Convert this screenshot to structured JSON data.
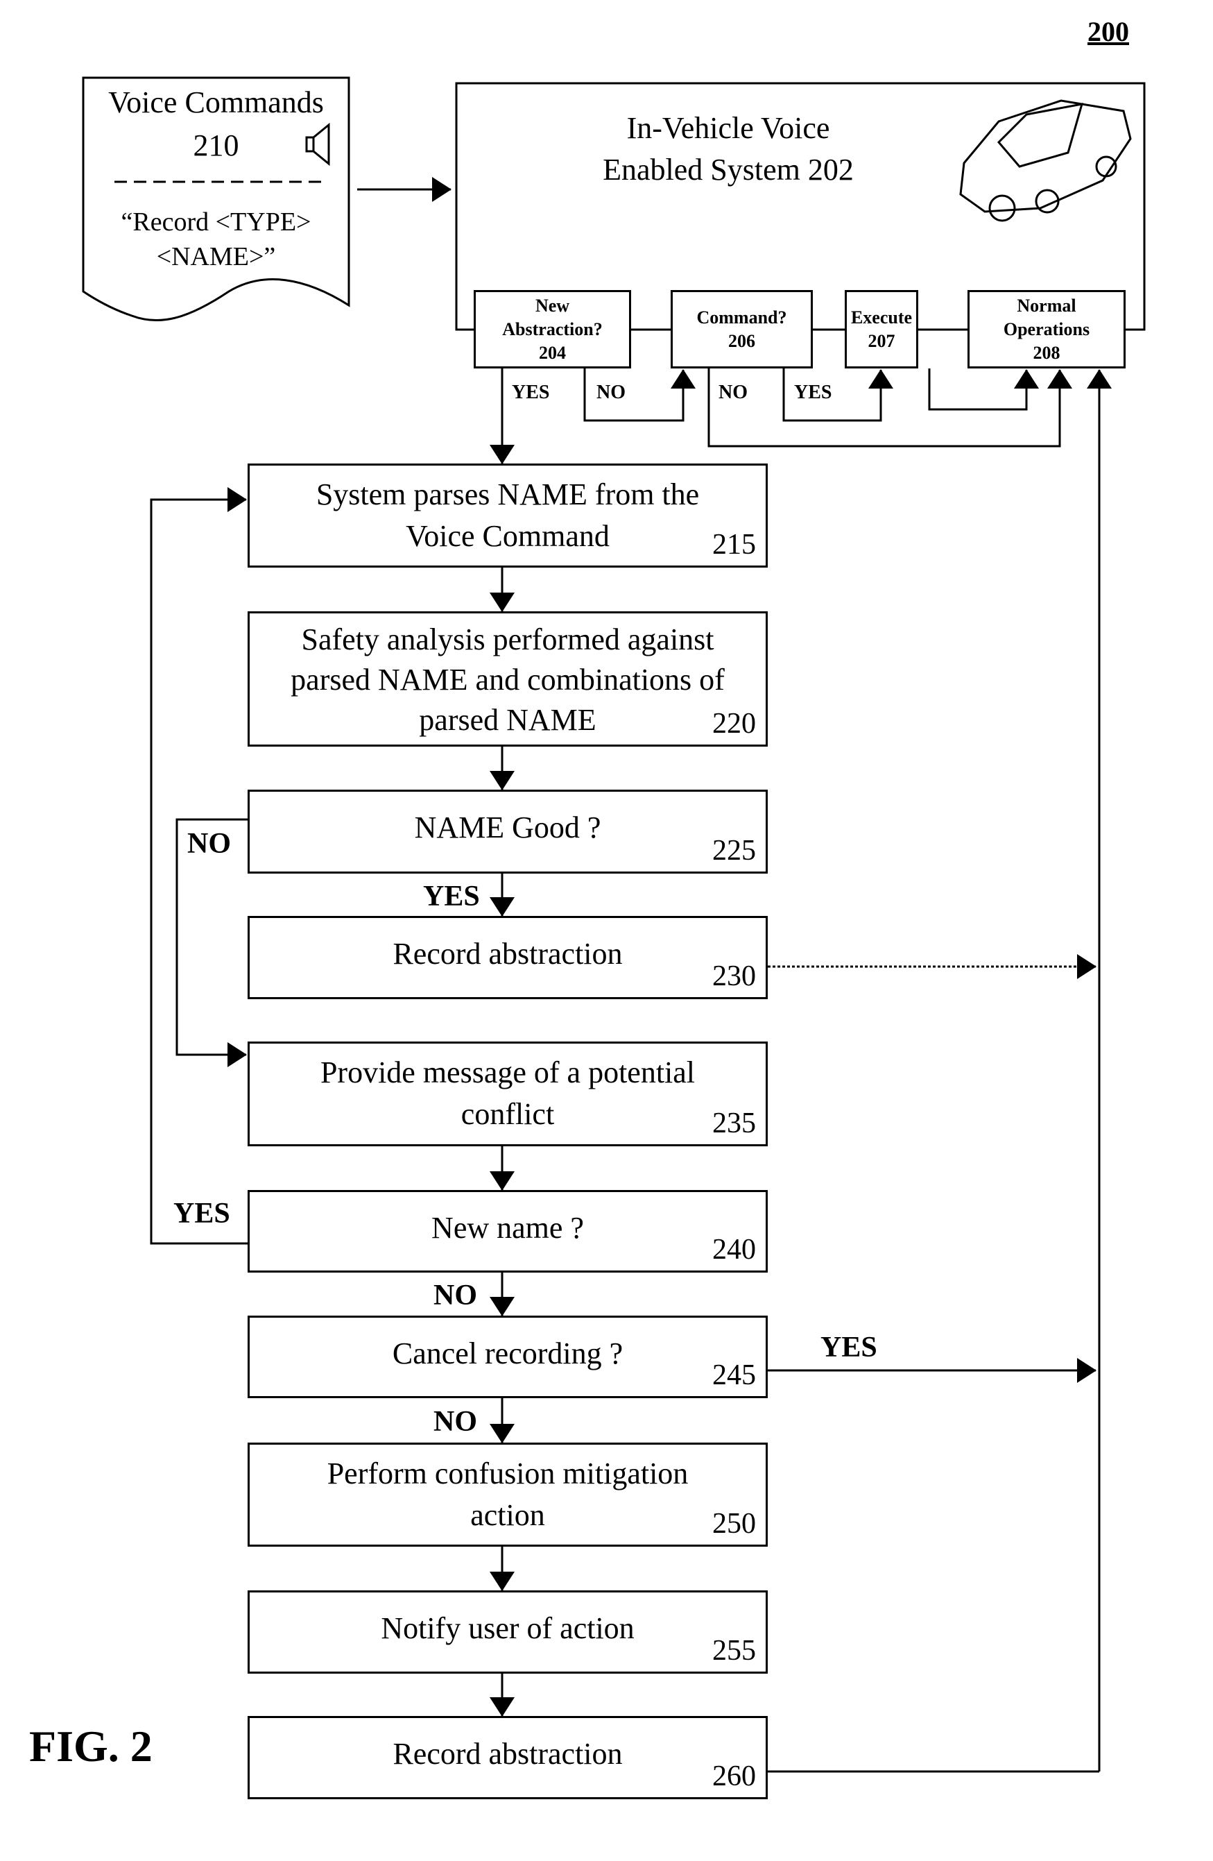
{
  "figure_ref": "200",
  "figure_label": "FIG. 2",
  "voice_commands": {
    "title": "Voice Commands",
    "number": "210",
    "command": "“Record <TYPE>",
    "command2": "<NAME>”",
    "icon": "speaker-icon"
  },
  "system": {
    "line1": "In-Vehicle Voice",
    "line2": "Enabled System 202",
    "icon": "car-icon"
  },
  "sub_steps": [
    {
      "lines": [
        "New",
        "Abstraction?",
        "204"
      ]
    },
    {
      "lines": [
        "Command?",
        "206"
      ]
    },
    {
      "lines": [
        "Execute",
        "207"
      ]
    },
    {
      "lines": [
        "Normal",
        "Operations",
        "208"
      ]
    }
  ],
  "sub_labels": {
    "yes204": "YES",
    "no204": "NO",
    "no206": "NO",
    "yes206": "YES"
  },
  "steps": [
    {
      "lines": [
        "System parses NAME from the",
        "Voice Command"
      ],
      "num": "215"
    },
    {
      "lines": [
        "Safety analysis performed against",
        "parsed NAME and combinations of",
        "parsed NAME"
      ],
      "num": "220"
    },
    {
      "lines": [
        "NAME Good ?"
      ],
      "num": "225"
    },
    {
      "lines": [
        "Record abstraction"
      ],
      "num": "230"
    },
    {
      "lines": [
        "Provide message of a potential",
        "conflict"
      ],
      "num": "235"
    },
    {
      "lines": [
        "New name ?"
      ],
      "num": "240"
    },
    {
      "lines": [
        "Cancel recording ?"
      ],
      "num": "245"
    },
    {
      "lines": [
        "Perform confusion mitigation",
        "action"
      ],
      "num": "250"
    },
    {
      "lines": [
        "Notify user of action"
      ],
      "num": "255"
    },
    {
      "lines": [
        "Record abstraction"
      ],
      "num": "260"
    }
  ],
  "branch_labels": {
    "no225": "NO",
    "yes225": "YES",
    "yes240": "YES",
    "no240": "NO",
    "yes245": "YES",
    "no245": "NO"
  }
}
